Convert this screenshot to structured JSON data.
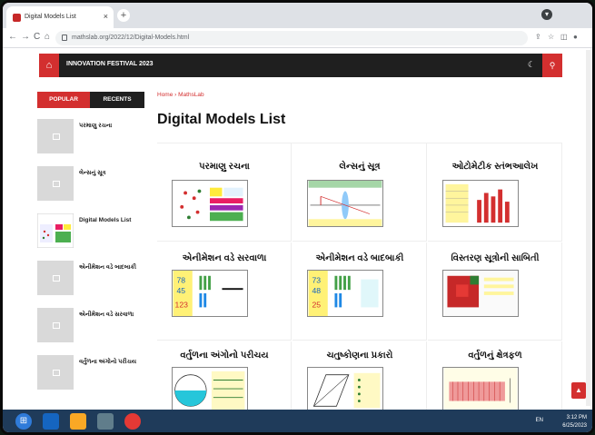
{
  "browser": {
    "tab_title": "Digital Models List",
    "tab_close": "×",
    "new_tab": "+",
    "url": "mathslab.org/2022/12/Digital-Models.html",
    "back": "←",
    "forward": "→",
    "reload": "C",
    "home": "⌂"
  },
  "site": {
    "festival": "INNOVATION FESTIVAL 2023",
    "home_icon": "⌂",
    "moon_icon": "☾",
    "search_icon": "⚲"
  },
  "sidebar": {
    "tabs": [
      "POPULAR",
      "RECENTS"
    ],
    "items": [
      {
        "title": "પરમાણુ રચના"
      },
      {
        "title": "લેન્સનું સૂત્ર"
      },
      {
        "title": "Digital Models List"
      },
      {
        "title": "એનીમેશન વડે બાદબાકી"
      },
      {
        "title": "એનીમેશન વડે સરવાળા"
      },
      {
        "title": "વર્તુળના અંગોનો પરીચય"
      }
    ]
  },
  "main": {
    "breadcrumb": "Home › MathsLab",
    "title": "Digital Models List",
    "cards": [
      {
        "title": "પરમાણુ રચના"
      },
      {
        "title": "લેન્સનું સૂત્ર"
      },
      {
        "title": "ઓટોમેટીક સ્તંભઆલેખ"
      },
      {
        "title": "એનીમેશન વડે સરવાળા"
      },
      {
        "title": "એનીમેશન વડે બાદબાકી"
      },
      {
        "title": "વિસ્તરણ સૂત્રોની સાબિતી"
      },
      {
        "title": "વર્તુળના અંગોનો પરીચય"
      },
      {
        "title": "ચતુષ્કોણના પ્રકારો"
      },
      {
        "title": "વર્તુળનું ક્ષેત્રફળ"
      }
    ]
  },
  "taskbar": {
    "lang": "EN",
    "time": "3:12 PM",
    "date": "6/25/2023"
  },
  "colors": {
    "accent": "#d32f2f",
    "dark": "#1f1f1f"
  }
}
